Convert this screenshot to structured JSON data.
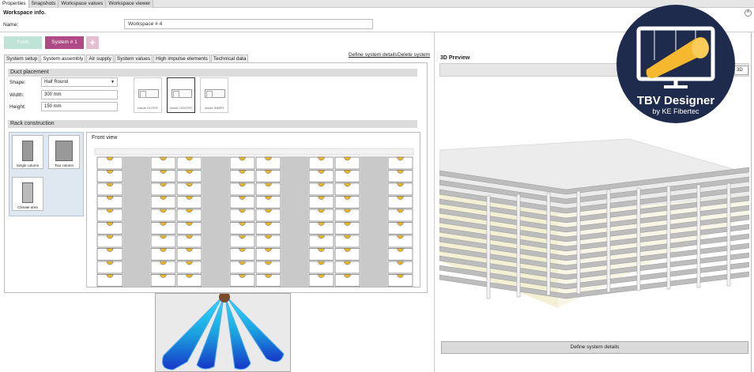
{
  "top_tabs": [
    "Properties",
    "Snapshots",
    "Workspace values",
    "Workspace viewer"
  ],
  "workspace_info_label": "Workspace info.",
  "name_label": "Name:",
  "name_value": "Workspace # 4",
  "system_buttons": {
    "form": "Form",
    "system1": "System # 1",
    "add": "+"
  },
  "define_system_details_link": "Define system details",
  "delete_system_link": "Delete system",
  "sub_tabs": [
    "System setup",
    "System assembly",
    "Air supply",
    "System values",
    "High impulse elements",
    "Technical data"
  ],
  "duct_placement": {
    "title": "Duct placement",
    "shape_label": "Shape:",
    "shape_value": "Half Round",
    "width_label": "Width:",
    "width_value": "300 mm",
    "height_label": "Height:",
    "height_value": "150 mm",
    "options": [
      "Inside OUTER",
      "Inside CENTER",
      "Inside INNER"
    ]
  },
  "rack_construction": {
    "title": "Rack construction",
    "options": [
      "Single column",
      "Two column",
      "Climate area"
    ]
  },
  "front_view_label": "Front view",
  "preview": {
    "title": "3D Preview",
    "view_mode": "3D",
    "button": "Define system details"
  },
  "logo": {
    "title": "TBV Designer",
    "subtitle": "by KE Fibertec"
  },
  "colors": {
    "system_button": "#b04a86",
    "form_button": "#bfe3d6",
    "logo_bg": "#1f2b4d",
    "logo_accent": "#f5b82e",
    "vent_yellow": "#e8b830"
  }
}
